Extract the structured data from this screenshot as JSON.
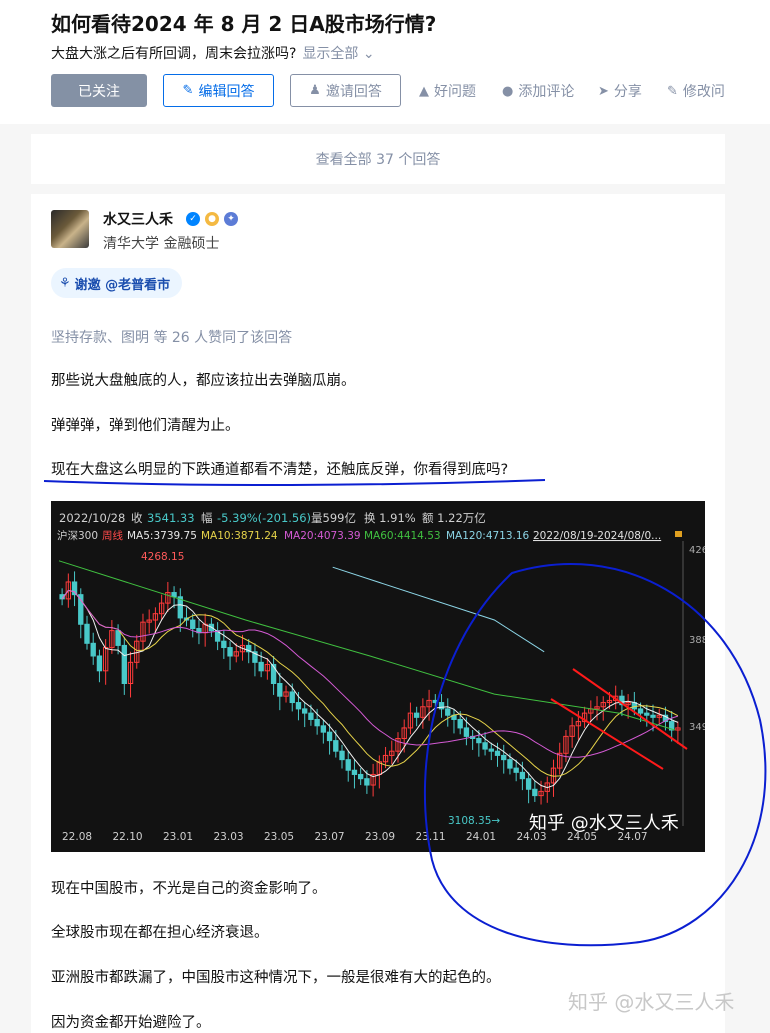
{
  "question": {
    "title": "如何看待2024 年 8 月 2 日A股市场行情?",
    "subtitle": "大盘大涨之后有所回调，周末会拉涨吗?",
    "show_all": "显示全部"
  },
  "actions": {
    "follow": "已关注",
    "write": "编辑回答",
    "invite": "邀请回答",
    "good_question": "好问题",
    "comment": "添加评论",
    "share": "分享",
    "edit": "修改问"
  },
  "all_answers": "查看全部 37 个回答",
  "answer": {
    "author": "水又三人禾",
    "bio": "清华大学 金融硕士",
    "thanks": "谢邀 @老普看市",
    "voters": "坚持存款、图明 等 26 人赞同了该回答",
    "paragraphs": [
      "那些说大盘触底的人，都应该拉出去弹脑瓜崩。",
      "弹弹弹，弹到他们清醒为止。",
      "现在大盘这么明显的下跌通道都看不清楚，还触底反弹，你看得到底吗?",
      "现在中国股市，不光是自己的资金影响了。",
      "全球股市现在都在担心经济衰退。",
      "亚洲股市都跌漏了，中国股市这种情况下，一般是很难有大的起色的。",
      "因为资金都开始避险了。"
    ],
    "watermark": "知乎 @水又三人禾"
  },
  "chart_data": {
    "type": "candlestick",
    "info_row1": {
      "date": "2022/10/28",
      "close_label": "收",
      "close": "3541.33",
      "change_label": "幅",
      "change": "-5.39%(-201.56)",
      "volume": "量599亿",
      "turnover": "换 1.91%",
      "amount": "额 1.22万亿"
    },
    "info_row2": {
      "index": "沪深300",
      "period": "周线",
      "ma5": "MA5:3739.75",
      "ma10": "MA10:3871.24",
      "ma20": "MA20:4073.39",
      "ma60": "MA60:4414.53",
      "ma120": "MA120:4713.16",
      "range": "2022/08/19-2024/08/0..."
    },
    "x_ticks": [
      "22.08",
      "22.10",
      "23.01",
      "23.03",
      "23.05",
      "23.07",
      "23.09",
      "23.11",
      "24.01",
      "24.03",
      "24.05",
      "24.07"
    ],
    "y_ticks": [
      "426",
      "388",
      "349"
    ],
    "high_label": "4268.15",
    "low_label": "3108.35",
    "watermark": "知乎 @水又三人禾",
    "closes": [
      4100,
      4180,
      4120,
      3980,
      3890,
      3830,
      3760,
      3870,
      3950,
      3880,
      3700,
      3800,
      3900,
      3990,
      4000,
      4030,
      4080,
      4130,
      4110,
      4010,
      4000,
      3960,
      3940,
      3980,
      3950,
      3900,
      3870,
      3830,
      3850,
      3880,
      3850,
      3800,
      3760,
      3790,
      3700,
      3640,
      3660,
      3610,
      3580,
      3560,
      3530,
      3500,
      3470,
      3430,
      3380,
      3340,
      3290,
      3270,
      3250,
      3220,
      3270,
      3330,
      3360,
      3380,
      3440,
      3490,
      3560,
      3540,
      3590,
      3620,
      3610,
      3580,
      3550,
      3530,
      3490,
      3450,
      3440,
      3420,
      3390,
      3380,
      3360,
      3340,
      3300,
      3280,
      3250,
      3200,
      3170,
      3190,
      3230,
      3300,
      3370,
      3450,
      3500,
      3520,
      3560,
      3580,
      3590,
      3610,
      3620,
      3640,
      3600,
      3610,
      3580,
      3560,
      3550,
      3540,
      3550,
      3520,
      3480,
      3490
    ]
  },
  "colors": {
    "up": "#ff3b3b",
    "down": "#49c9c9",
    "accent": "#056de8",
    "annotation": "#0b1fd1"
  }
}
